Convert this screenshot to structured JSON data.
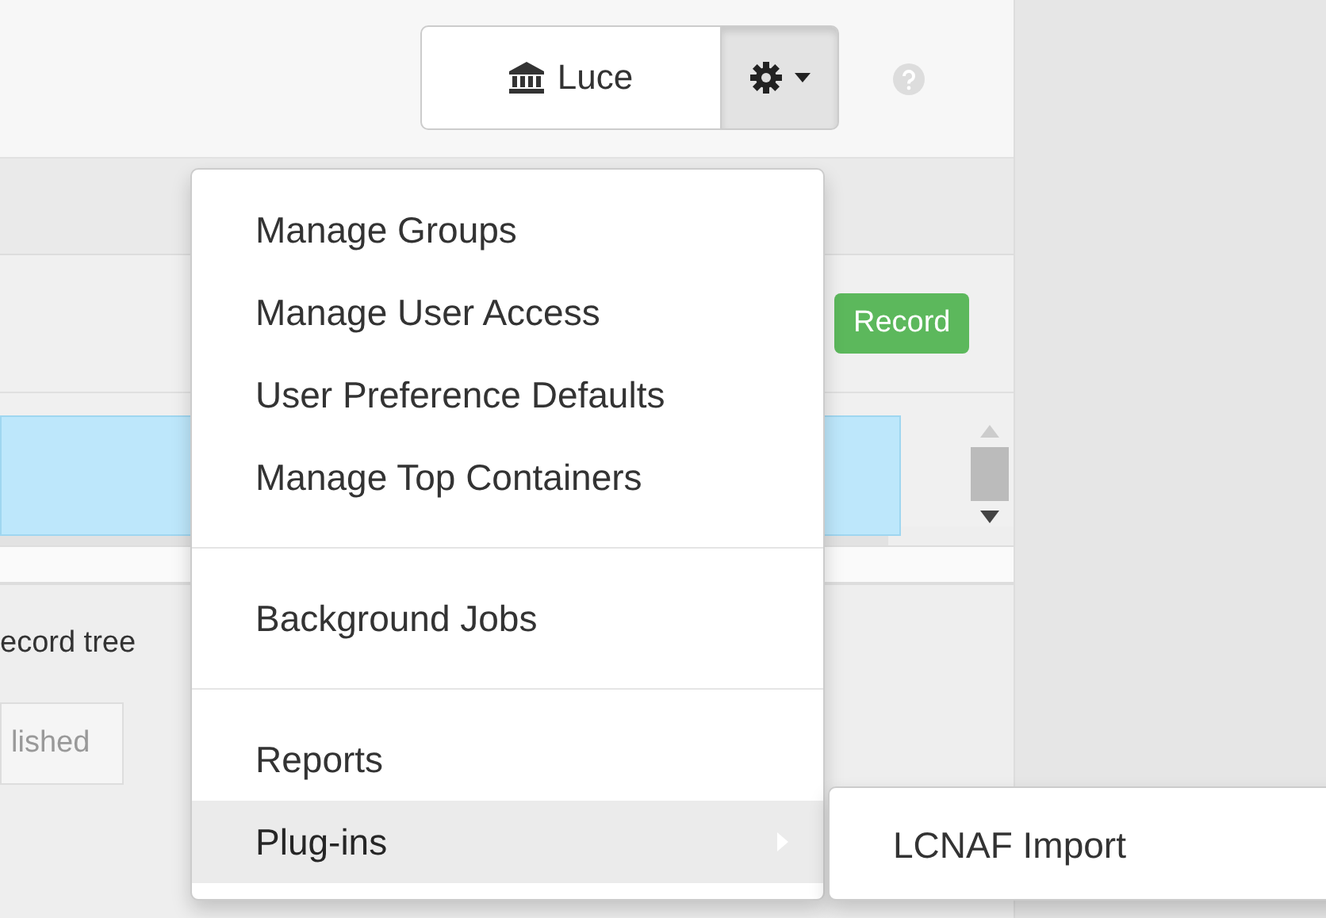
{
  "header": {
    "repository_button": {
      "label": "Luce"
    },
    "settings_button": {
      "expanded": true
    }
  },
  "toolbar": {
    "record_button": {
      "label": "Record"
    }
  },
  "tree": {
    "rows": [
      {
        "selected": true
      }
    ]
  },
  "tree_toggle": {
    "label": "ecord tree"
  },
  "tabs": [
    {
      "label": "lished"
    }
  ],
  "menu": {
    "items": [
      {
        "kind": "item",
        "label": "Manage Groups",
        "selected": false
      },
      {
        "kind": "item",
        "label": "Manage User Access",
        "selected": false
      },
      {
        "kind": "item",
        "label": "User Preference Defaults",
        "selected": false
      },
      {
        "kind": "item",
        "label": "Manage Top Containers",
        "selected": false
      },
      {
        "kind": "divider"
      },
      {
        "kind": "item",
        "label": "Background Jobs",
        "selected": false
      },
      {
        "kind": "divider"
      },
      {
        "kind": "item",
        "label": "Reports",
        "selected": false
      },
      {
        "kind": "submenu",
        "label": "Plug-ins",
        "selected": true,
        "children": [
          {
            "label": "LCNAF Import"
          }
        ]
      }
    ]
  }
}
